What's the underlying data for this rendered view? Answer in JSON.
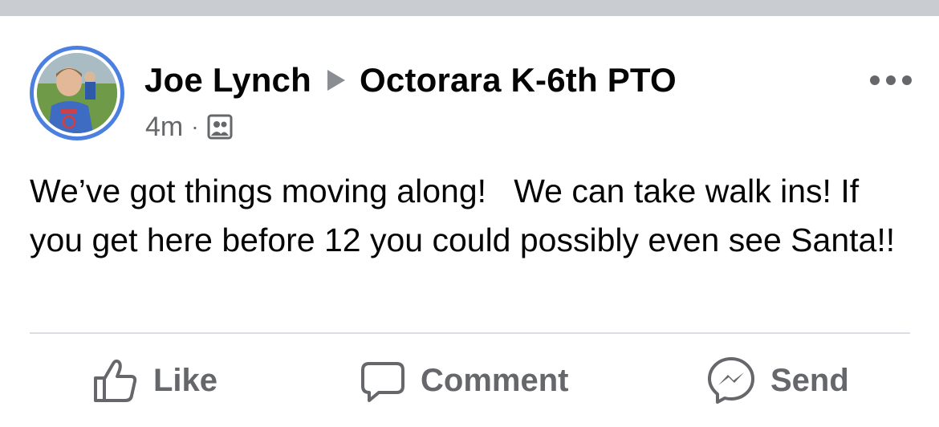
{
  "post": {
    "author": "Joe Lynch",
    "group": "Octorara K-6th PTO",
    "timestamp": "4m",
    "separator": "·",
    "audience_icon": "group-icon",
    "more_icon": "more-horizontal-icon",
    "body": "We’ve got things moving along!   We can take walk ins! If you get here before 12 you could possibly even see Santa!!"
  },
  "actions": {
    "like_label": "Like",
    "comment_label": "Comment",
    "send_label": "Send"
  },
  "colors": {
    "avatar_ring": "#4b7fe0",
    "secondary_text": "#65676b",
    "primary_text": "#050505",
    "divider": "#dadde1"
  }
}
